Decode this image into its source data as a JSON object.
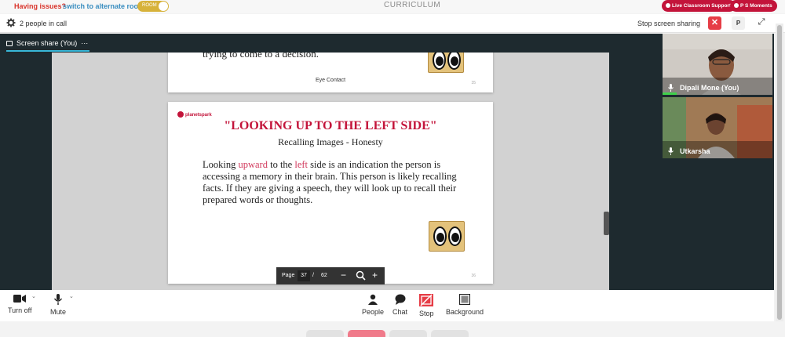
{
  "topbar": {
    "issues": "Having issues?",
    "switch_link": "switch to alternate room",
    "toggle_label": "ROOM",
    "title": "CURRICULUM",
    "support_button": "Live Classroom Support",
    "moments_button": "P S Moments"
  },
  "callbar": {
    "people_count": "2 people in call",
    "stop_sharing": "Stop screen sharing",
    "close": "✕",
    "p_button": "P",
    "expand": "⤢"
  },
  "stage": {
    "tab_label": "Screen share (You)",
    "tab_more": "···"
  },
  "slides": {
    "prev_text": "trying to come to a decision.",
    "prev_caption": "Eye Contact",
    "prev_number": "35",
    "logo": "planetspark",
    "title": "\"LOOKING UP TO THE LEFT SIDE\"",
    "subtitle": "Recalling Images - Honesty",
    "body_1": "Looking ",
    "body_hl1": "upward",
    "body_2": " to the ",
    "body_hl2": "left",
    "body_3": " side is an indication the person is accessing a memory in their brain. This person is likely recalling facts. If they are giving a speech, they will look up to recall their prepared words or thoughts.",
    "number": "36"
  },
  "pagebar": {
    "label": "Page",
    "page": "37",
    "separator": "/",
    "total": "62",
    "zoom_out": "−",
    "zoom_in": "+"
  },
  "participants": [
    {
      "name": "Dipali Mone (You)"
    },
    {
      "name": "Utkarsha"
    }
  ],
  "controls": {
    "camera": "Turn off",
    "mic": "Mute",
    "people": "People",
    "chat": "Chat",
    "stop": "Stop",
    "background": "Background"
  },
  "colors": {
    "accent": "#c3143a",
    "stop_red": "#e63d46",
    "stage_bg": "#1e2a2f",
    "speaking_green": "#3fd24b"
  }
}
